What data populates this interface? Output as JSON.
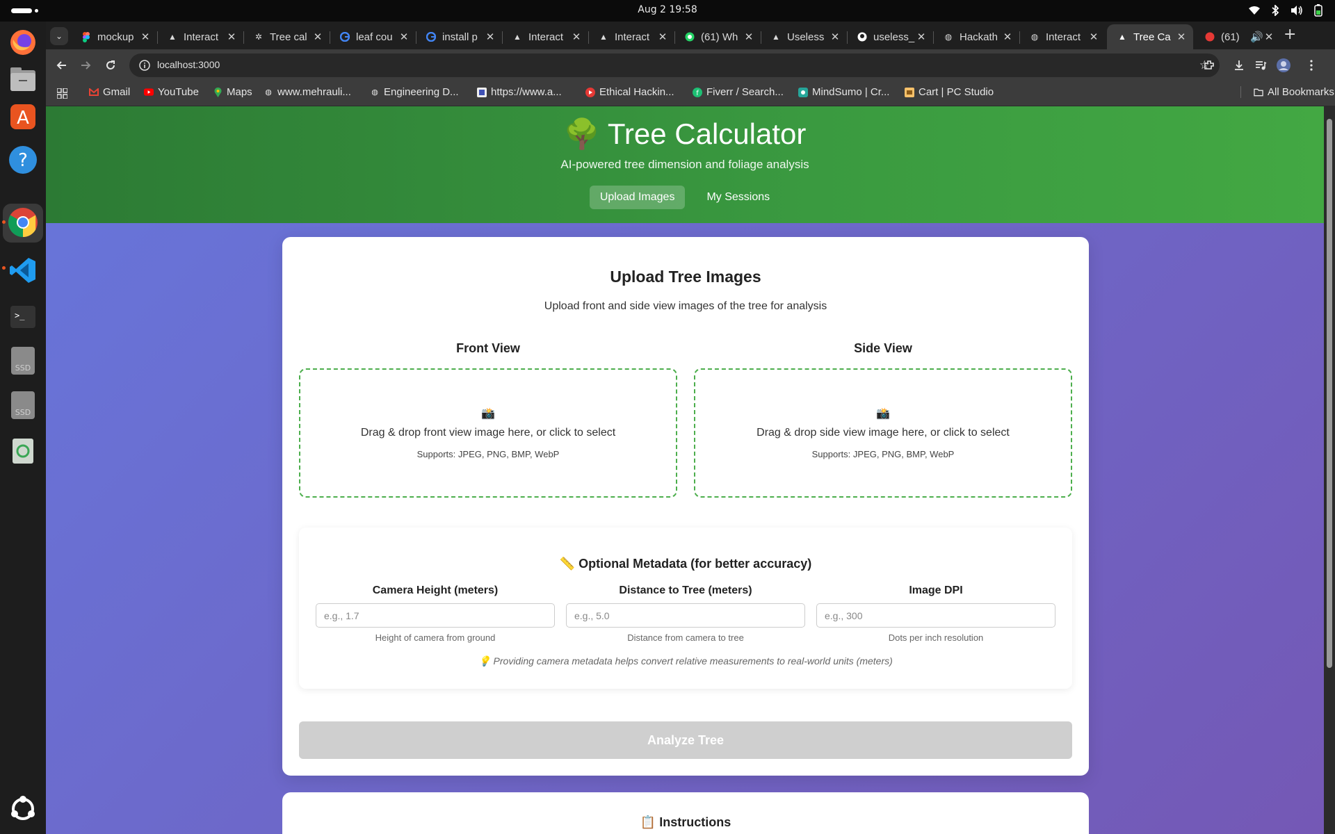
{
  "system": {
    "clock": "Aug 2  19:58"
  },
  "browser": {
    "tabs": [
      {
        "title": "mockup",
        "favicon": "figma-icon"
      },
      {
        "title": "Interact",
        "favicon": "vercel-icon"
      },
      {
        "title": "Tree cal",
        "favicon": "openai-icon"
      },
      {
        "title": "leaf cou",
        "favicon": "google-icon"
      },
      {
        "title": "install p",
        "favicon": "google-icon"
      },
      {
        "title": "Interact",
        "favicon": "vercel-icon"
      },
      {
        "title": "Interact",
        "favicon": "vercel-icon"
      },
      {
        "title": "(61) Wh",
        "favicon": "whatsapp-icon"
      },
      {
        "title": "Useless",
        "favicon": "vercel-icon"
      },
      {
        "title": "useless_",
        "favicon": "github-icon"
      },
      {
        "title": "Hackath",
        "favicon": "globe-icon"
      },
      {
        "title": "Interact",
        "favicon": "globe-icon"
      },
      {
        "title": "Tree Ca",
        "favicon": "vercel-icon"
      },
      {
        "title": "(61)",
        "favicon": "notification-icon"
      }
    ],
    "url": "localhost:3000",
    "bookmarks": [
      {
        "label": "Gmail"
      },
      {
        "label": "YouTube"
      },
      {
        "label": "Maps"
      },
      {
        "label": "www.mehrauli..."
      },
      {
        "label": "Engineering D..."
      },
      {
        "label": "https://www.a..."
      },
      {
        "label": "Ethical Hackin..."
      },
      {
        "label": "Fiverr / Search..."
      },
      {
        "label": "MindSumo | Cr..."
      },
      {
        "label": "Cart | PC Studio"
      }
    ],
    "all_bookmarks": "All Bookmarks"
  },
  "app": {
    "title": "🌳 Tree Calculator",
    "subtitle": "AI-powered tree dimension and foliage analysis",
    "nav": {
      "upload": "Upload Images",
      "sessions": "My Sessions"
    },
    "upload": {
      "title": "Upload Tree Images",
      "subtitle": "Upload front and side view images of the tree for analysis",
      "front": {
        "title": "Front View",
        "icon": "📸",
        "text": "Drag & drop front view image here, or click to select",
        "supports": "Supports: JPEG, PNG, BMP, WebP"
      },
      "side": {
        "title": "Side View",
        "icon": "📸",
        "text": "Drag & drop side view image here, or click to select",
        "supports": "Supports: JPEG, PNG, BMP, WebP"
      }
    },
    "metadata": {
      "title": "📏 Optional Metadata (for better accuracy)",
      "fields": [
        {
          "label": "Camera Height (meters)",
          "placeholder": "e.g., 1.7",
          "help": "Height of camera from ground"
        },
        {
          "label": "Distance to Tree (meters)",
          "placeholder": "e.g., 5.0",
          "help": "Distance from camera to tree"
        },
        {
          "label": "Image DPI",
          "placeholder": "e.g., 300",
          "help": "Dots per inch resolution"
        }
      ],
      "note": "💡 Providing camera metadata helps convert relative measurements to real-world units (meters)"
    },
    "analyze": "Analyze Tree",
    "instructions_title": "📋 Instructions"
  },
  "colors": {
    "header_green": "#3a9a40",
    "background_purple": "#6f66cf",
    "dropzone_border": "#4cae4c",
    "disabled_button": "#cfcfcf"
  }
}
